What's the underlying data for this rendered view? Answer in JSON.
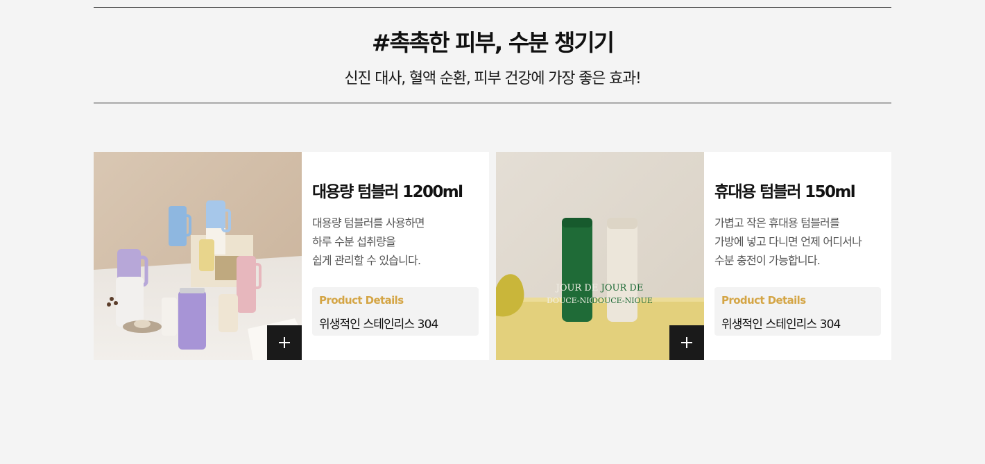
{
  "header": {
    "title": "#촉촉한 피부, 수분 챙기기",
    "subtitle": "신진 대사, 혈액 순환, 피부 건강에 가장 좋은 효과!"
  },
  "products": [
    {
      "name": "대용량 텀블러 1200ml",
      "description": [
        "대용량 텀블러를 사용하면",
        "하루 수분 섭취량을",
        "쉽게 관리할 수 있습니다."
      ],
      "details_label": "Product Details",
      "details_value": "위생적인 스테인리스 304",
      "image_icon": "tumbler-product-photo",
      "button_icon": "plus-icon"
    },
    {
      "name": "휴대용 텀블러 150ml",
      "description": [
        "가볍고 작은 휴대용 텀블러를",
        "가방에 넣고 다니면 언제 어디서나",
        "수분 충전이 가능합니다."
      ],
      "details_label": "Product Details",
      "details_value": "위생적인 스테인리스 304",
      "image_icon": "mini-bottle-product-photo",
      "image_text": [
        "JOUR DE",
        "DOUCE-NIOUE"
      ],
      "button_icon": "plus-icon"
    }
  ],
  "colors": {
    "background": "#f4f4f4",
    "card": "#ffffff",
    "accent": "#d4a545",
    "button": "#1a1a1a"
  }
}
